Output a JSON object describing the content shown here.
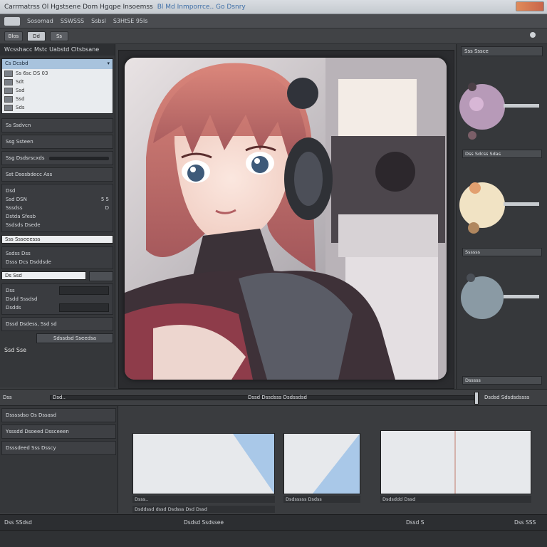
{
  "window": {
    "title": "Carrmatrss Ol Hgstsene Dom Hgqpe Insoemss",
    "title_accent": "Bl Md Inmporrce.. Go Dsnry"
  },
  "menu": {
    "items": [
      "Sosomad",
      "SSWSSS",
      "Ssbsl",
      "S3HtSE 95ls"
    ]
  },
  "toolbar": {
    "buttons": [
      "Blos",
      "Dd",
      "Ss"
    ]
  },
  "left_panel": {
    "header": "Wcsshacc Mstc Uabstd Cltsbsane",
    "layer_list": {
      "title": "Cs Dcsbd",
      "layers": [
        "Ss 6sc DS 03",
        "Sdt",
        "Ssd",
        "Ssd",
        "Sds"
      ]
    },
    "section_1": "Ss Ssdvcn",
    "section_2": "Ssg Ssteen",
    "section_3": "Ssg Dsdsrscxds",
    "section_4": "Sst Dsosbdecc Ass",
    "props": {
      "title": "Dsd",
      "lines": [
        "Ssd DSN",
        "Sssdss",
        "Dstda Sfesb",
        "Ssdsds Dsede"
      ],
      "values": [
        "5 5",
        "D",
        ""
      ]
    },
    "white_field": "Sss Ssseeesss",
    "field_rows": [
      "Ssdss Dss",
      "Dsss Dcs Dsddsde"
    ],
    "white_field_2": "Ds Ssd",
    "extra_rows": [
      "Dss",
      "Dsdd Sssdsd",
      "Dsdds"
    ],
    "bottom_rows": [
      "Dssd Dsdess, Ssd sd",
      "Sdssdsd Sseedsa",
      "Ssd Sse"
    ]
  },
  "right_panel": {
    "header": "Sss Sssce",
    "labels": [
      "Dss Sdcss Sdas",
      "Ssssss",
      "Dsssss"
    ]
  },
  "scrubber": {
    "label_left": "Dss",
    "label_left_2": "Dsd..",
    "label_mid": "Dssd Dssdsss Dsdssdsd",
    "label_right": "Dsdsd Sdsdsdssss"
  },
  "bottom_left": {
    "rows": [
      "Dssssdso Os Dssasd",
      "Ysssdd Dsoeed Dssceeen",
      "Dsssdeed Sss Dsscy"
    ]
  },
  "previews": {
    "captions": [
      "Dsss..",
      "Dsddssd dssd Dsdsss Dsd Dssd",
      "Dsdsssss Dsdss",
      "Dsdsddd Dssd"
    ]
  },
  "status": {
    "left": "Dss SSdsd",
    "mid": "Dsdsd Ssdssee",
    "right": "Dssd S",
    "far_right": "Dss SSS"
  },
  "colors": {
    "accent": "#3f6fa8",
    "panel": "#35373a",
    "selection": "#a8c3dd"
  }
}
